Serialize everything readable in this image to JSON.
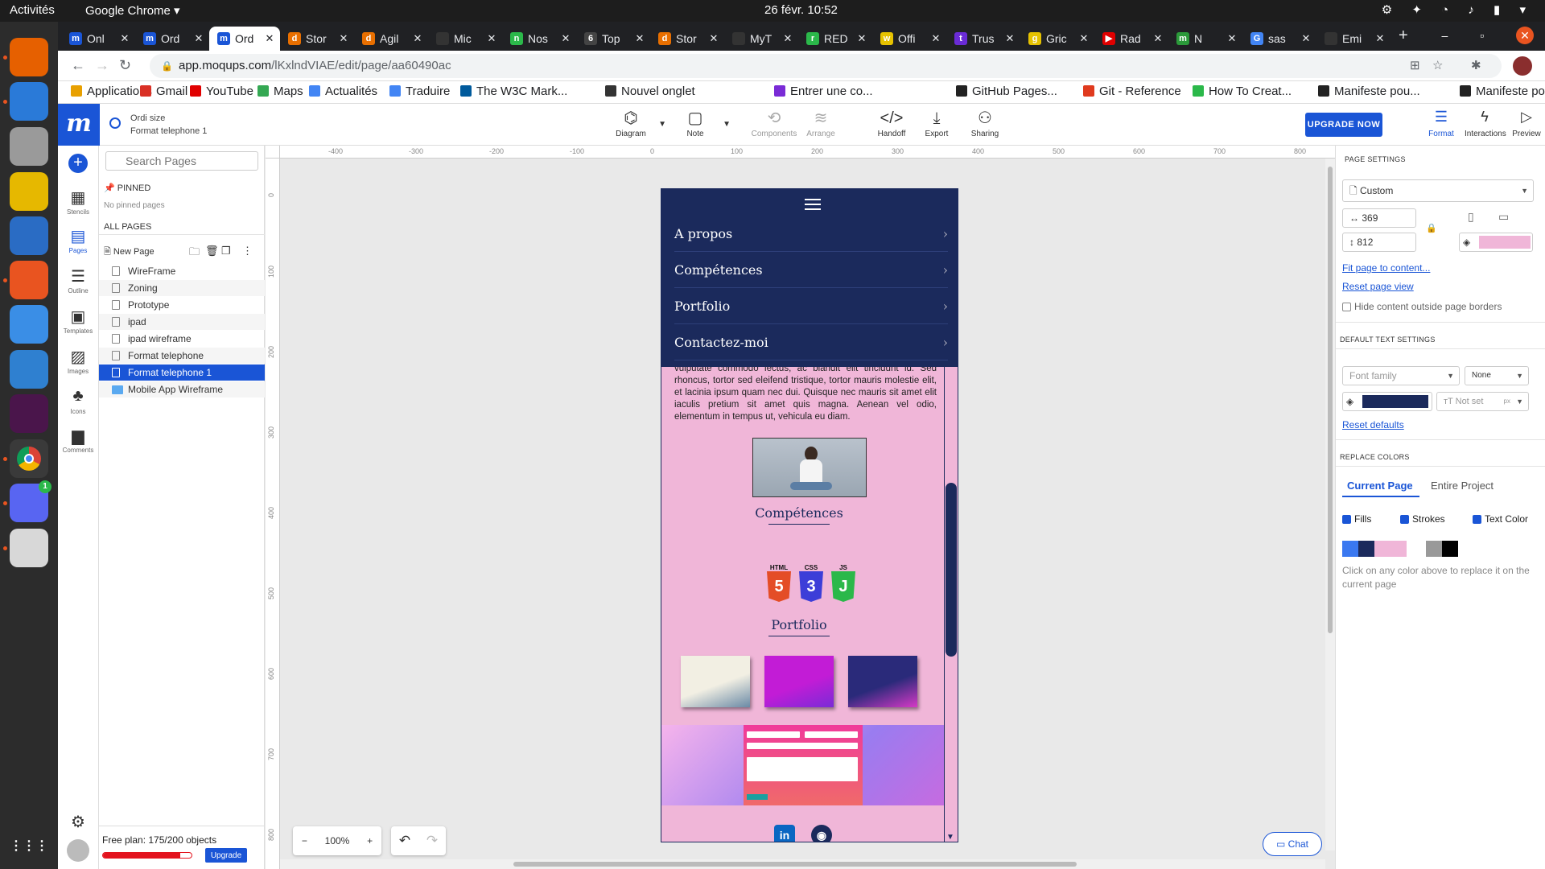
{
  "system": {
    "activities": "Activités",
    "app_menu": "Google Chrome ▾",
    "clock": "26 févr.  10:52"
  },
  "colors": {
    "accent": "#1a55d6",
    "nav_bg": "#1b2a5c",
    "page_bg": "#f0b6d8",
    "dock_bg": "#2c2c2c"
  },
  "dock": [
    {
      "name": "firefox",
      "color": "#e66000"
    },
    {
      "name": "thunderbird",
      "color": "#2a7ad8"
    },
    {
      "name": "files",
      "color": "#9a9a9a"
    },
    {
      "name": "rhythmbox",
      "color": "#e6b800"
    },
    {
      "name": "writer",
      "color": "#2a6cc4"
    },
    {
      "name": "app-center",
      "color": "#e95420"
    },
    {
      "name": "help",
      "color": "#3a8ee6"
    },
    {
      "name": "vscode",
      "color": "#2f80d0"
    },
    {
      "name": "slack",
      "color": "#4a154b"
    },
    {
      "name": "chrome",
      "color": "#2b6ad6"
    },
    {
      "name": "discord",
      "color": "#5865f2",
      "badge": "1"
    },
    {
      "name": "screenshot-tool",
      "color": "#d8d8d8"
    }
  ],
  "tabs": [
    {
      "label": "Onl",
      "icon": "m",
      "color": "#1a55d6"
    },
    {
      "label": "Ord",
      "icon": "m",
      "color": "#1a55d6"
    },
    {
      "label": "Ord",
      "icon": "m",
      "color": "#1a55d6",
      "active": true
    },
    {
      "label": "Stor",
      "icon": "d",
      "color": "#e86f00"
    },
    {
      "label": "Agil",
      "icon": "d",
      "color": "#e86f00"
    },
    {
      "label": "Mic",
      "icon": "",
      "color": "#333333"
    },
    {
      "label": "Nos",
      "icon": "n",
      "color": "#2bb84a"
    },
    {
      "label": "Top",
      "icon": "6",
      "color": "#444444"
    },
    {
      "label": "Stor",
      "icon": "d",
      "color": "#e86f00"
    },
    {
      "label": "MyT",
      "icon": "",
      "color": "#333333"
    },
    {
      "label": "RED",
      "icon": "r",
      "color": "#2bb84a"
    },
    {
      "label": "Offi",
      "icon": "w",
      "color": "#e6c200"
    },
    {
      "label": "Trus",
      "icon": "t",
      "color": "#6a2bd6"
    },
    {
      "label": "Gric",
      "icon": "g",
      "color": "#e6c200"
    },
    {
      "label": "Rad",
      "icon": "▶",
      "color": "#e00000"
    },
    {
      "label": "N",
      "icon": "m",
      "color": "#2b9a3a"
    },
    {
      "label": "sas",
      "icon": "G",
      "color": "#4285f4"
    },
    {
      "label": "Emi",
      "icon": "",
      "color": "#333333"
    }
  ],
  "omnibox": {
    "host": "app.moqups.com",
    "path": "/lKxlndVIAE/edit/page/aa60490ac"
  },
  "bookmarks": [
    {
      "label": "Applications",
      "color": "#e8a000"
    },
    {
      "label": "Gmail",
      "color": "#d93025"
    },
    {
      "label": "YouTube",
      "color": "#e00000"
    },
    {
      "label": "Maps",
      "color": "#34a853"
    },
    {
      "label": "Actualités",
      "color": "#4285f4"
    },
    {
      "label": "Traduire",
      "color": "#4285f4"
    },
    {
      "label": "The W3C Mark...",
      "color": "#005a9c"
    },
    {
      "label": "Nouvel onglet",
      "color": "#333333"
    },
    {
      "label": "Entrer une co...",
      "color": "#7a2bd6"
    },
    {
      "label": "GitHub Pages...",
      "color": "#222222"
    },
    {
      "label": "Git - Reference",
      "color": "#e03a1e"
    },
    {
      "label": "How To Creat...",
      "color": "#2bb84a"
    },
    {
      "label": "Manifeste pou...",
      "color": "#222222"
    },
    {
      "label": "Manifeste pou...",
      "color": "#222222"
    }
  ],
  "moqups": {
    "logo": "m",
    "project_title": "Ordi size",
    "page_title": "Format telephone 1",
    "tools": [
      {
        "label": "Diagram",
        "icon": "⌬",
        "dim": false,
        "dropdown": true
      },
      {
        "label": "Note",
        "icon": "▢",
        "dim": false,
        "dropdown": true
      },
      {
        "label": "Components",
        "icon": "⟲",
        "dim": true
      },
      {
        "label": "Arrange",
        "icon": "≋",
        "dim": true
      },
      {
        "label": "Handoff",
        "icon": "</>",
        "dim": false
      },
      {
        "label": "Export",
        "icon": "⤓",
        "dim": false
      },
      {
        "label": "Sharing",
        "icon": "⚇",
        "dim": false
      }
    ],
    "upgrade": "UPGRADE NOW",
    "right_tools": [
      {
        "label": "Format",
        "icon": "☰",
        "selected": true
      },
      {
        "label": "Interactions",
        "icon": "ϟ",
        "selected": false
      },
      {
        "label": "Preview",
        "icon": "▷",
        "selected": false
      }
    ]
  },
  "left_rail": [
    {
      "label": "Stencils",
      "icon": "▦"
    },
    {
      "label": "Pages",
      "icon": "▤",
      "selected": true
    },
    {
      "label": "Outline",
      "icon": "☰"
    },
    {
      "label": "Templates",
      "icon": "▣"
    },
    {
      "label": "Images",
      "icon": "▨"
    },
    {
      "label": "Icons",
      "icon": "♣"
    },
    {
      "label": "Comments",
      "icon": "▆"
    }
  ],
  "pages_panel": {
    "search_placeholder": "Search Pages",
    "pinned": "PINNED",
    "no_pinned": "No pinned pages",
    "all_pages": "ALL PAGES",
    "new_page": "New Page",
    "items": [
      {
        "label": "WireFrame",
        "type": "page"
      },
      {
        "label": "Zoning",
        "type": "page"
      },
      {
        "label": "Prototype",
        "type": "page"
      },
      {
        "label": "ipad",
        "type": "page"
      },
      {
        "label": "ipad wireframe",
        "type": "page"
      },
      {
        "label": "Format telephone",
        "type": "page"
      },
      {
        "label": "Format telephone 1",
        "type": "page",
        "selected": true
      },
      {
        "label": "Mobile App Wireframe",
        "type": "folder"
      }
    ],
    "free_plan": "Free plan: 175/200 objects",
    "objects_used": 175,
    "objects_limit": 200,
    "upgrade": "Upgrade"
  },
  "ruler": {
    "h": [
      "-400",
      "-300",
      "-200",
      "-100",
      "0",
      "100",
      "200",
      "300",
      "400",
      "500",
      "600",
      "700",
      "800"
    ],
    "v": [
      "0",
      "100",
      "200",
      "300",
      "400",
      "500",
      "600",
      "700",
      "800"
    ]
  },
  "canvas": {
    "zoom": "100%",
    "chat": "Chat"
  },
  "mockup": {
    "nav_items": [
      "A propos",
      "Compétences",
      "Portfolio",
      "Contactez-moi"
    ],
    "paragraph": "vulputate commodo lectus, ac blandit elit tincidunt id. Sed rhoncus, tortor sed eleifend tristique, tortor mauris molestie elit, et lacinia ipsum quam nec dui. Quisque nec mauris sit amet elit iaculis pretium sit amet quis magna. Aenean vel odio, elementum in tempus ut, vehicula eu diam.",
    "competences_title": "Compétences",
    "badges": [
      {
        "label": "HTML",
        "num": "5",
        "color": "#e44d26"
      },
      {
        "label": "CSS",
        "num": "3",
        "color": "#3c3ed8"
      },
      {
        "label": "JS",
        "num": "J",
        "color": "#2bb84a"
      }
    ],
    "portfolio_title": "Portfolio",
    "thumbs": [
      {
        "c1": "#f2efe3",
        "c2": "#6a8aa6"
      },
      {
        "c1": "#c21cd6",
        "c2": "#7a2bd6"
      },
      {
        "c1": "#2a2a7a",
        "c2": "#d63ac6"
      }
    ],
    "social": [
      {
        "name": "linkedin",
        "text": "in",
        "color": "#0a66c2"
      },
      {
        "name": "github",
        "text": "◉",
        "color": "#1b2a5c"
      }
    ]
  },
  "right_panel": {
    "page_settings": "PAGE SETTINGS",
    "size_preset": "Custom",
    "width": "369",
    "height": "812",
    "bg_color": "#f0b6d8",
    "fit_page": "Fit page to content...",
    "reset_view": "Reset page view",
    "hide_outside": "Hide content outside page borders",
    "default_text": "DEFAULT TEXT SETTINGS",
    "font_family": "Font family",
    "font_size": "None",
    "text_color": "#1b2a5c",
    "not_set": "Not set",
    "px": "px",
    "reset_defaults": "Reset defaults",
    "replace_colors": "REPLACE COLORS",
    "tab_current": "Current Page",
    "tab_entire": "Entire Project",
    "fills": "Fills",
    "strokes": "Strokes",
    "text_color_label": "Text Color",
    "swatches": [
      "#3a78f0",
      "#1b2a5c",
      "#f0b6d8",
      "#f0b6d8",
      "#999999",
      "#000000"
    ],
    "hint": "Click on any color above to replace it on the current page"
  }
}
